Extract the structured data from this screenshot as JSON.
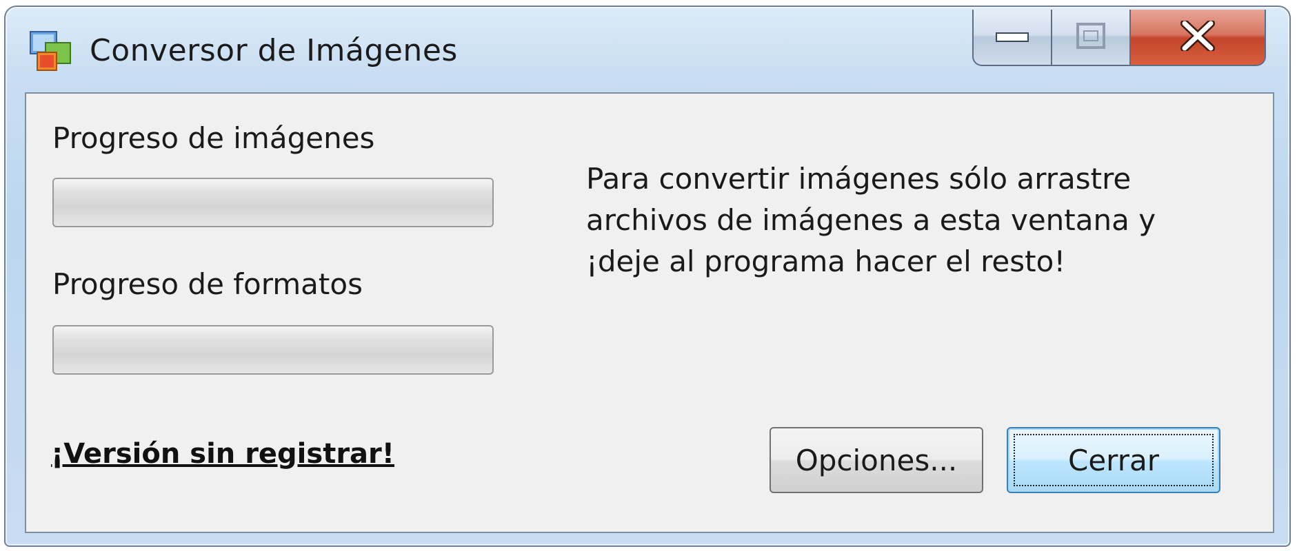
{
  "window": {
    "title": "Conversor de Imágenes"
  },
  "captions": {
    "minimize_icon": "minimize-icon",
    "maximize_icon": "maximize-icon",
    "close_icon": "close-icon"
  },
  "main": {
    "images_progress_label": "Progreso de imágenes",
    "images_progress_value": 0,
    "formats_progress_label": "Progreso de formatos",
    "formats_progress_value": 0,
    "instructions": "Para convertir imágenes sólo arrastre\narchivos de imágenes a esta ventana y\n¡deje al programa hacer el resto!",
    "unregistered_link": "¡Versión sin registrar!",
    "options_button": "Opciones...",
    "close_button": "Cerrar"
  },
  "colors": {
    "client_background": "#f0f0f0",
    "close_caption": "#c3442a",
    "focused_button_border": "#3c7fb1"
  }
}
